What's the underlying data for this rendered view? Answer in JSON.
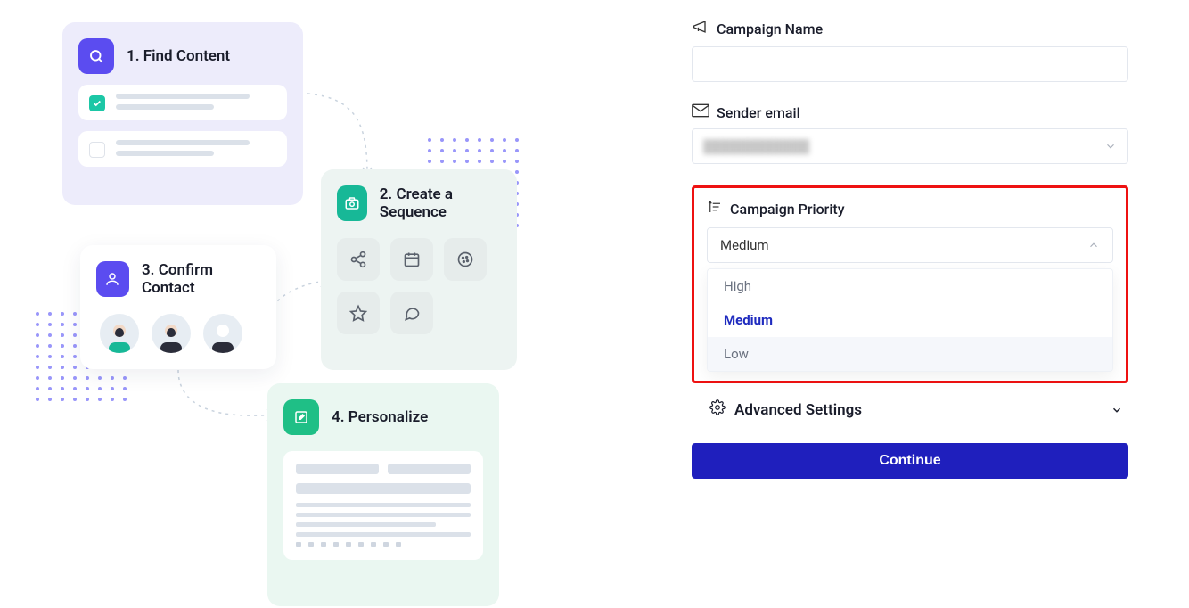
{
  "illustration": {
    "step1": {
      "number": "1.",
      "title": "Find Content"
    },
    "step2": {
      "number": "2.",
      "title": "Create a Sequence"
    },
    "step3": {
      "number": "3.",
      "title": "Confirm Contact"
    },
    "step4": {
      "number": "4.",
      "title": "Personalize"
    }
  },
  "form": {
    "campaign_name": {
      "label": "Campaign Name",
      "value": ""
    },
    "sender_email": {
      "label": "Sender email",
      "value": ""
    },
    "priority": {
      "label": "Campaign Priority",
      "selected": "Medium",
      "options": [
        "High",
        "Medium",
        "Low"
      ]
    },
    "advanced_settings": {
      "label": "Advanced Settings"
    },
    "continue_label": "Continue"
  },
  "colors": {
    "highlight_border": "#e11",
    "primary_button": "#1f1fbd",
    "accent_violet": "#5b4cf0",
    "accent_teal": "#17b897"
  }
}
